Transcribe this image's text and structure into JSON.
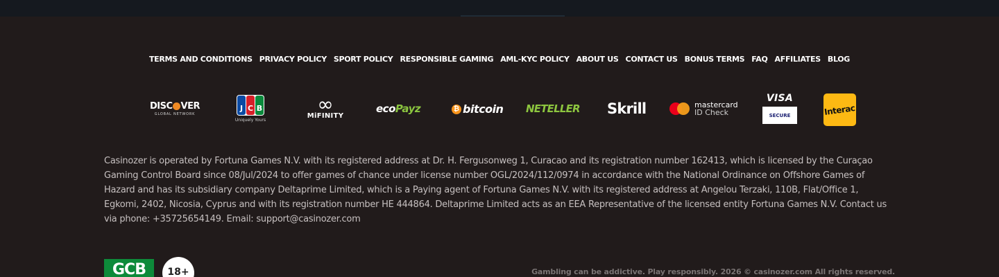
{
  "footer_links": [
    "TERMS AND CONDITIONS",
    "PRIVACY POLICY",
    "SPORT POLICY",
    "RESPONSIBLE GAMING",
    "AML-KYC POLICY",
    "ABOUT US",
    "CONTACT US",
    "BONUS TERMS",
    "FAQ",
    "AFFILIATES",
    "BLOG"
  ],
  "payments": {
    "discover": {
      "name_a": "DISC",
      "name_b": "VER",
      "sub": "GLOBAL NETWORK"
    },
    "jcb": {
      "j": "J",
      "c": "C",
      "b": "B",
      "sub": "Uniquely Yours"
    },
    "mifinity": {
      "name": "MiFINITY"
    },
    "ecopayz": {
      "eco": "eco",
      "payz": "Payz"
    },
    "bitcoin": {
      "symbol": "₿",
      "name": "bitcoin"
    },
    "neteller": {
      "name": "NETELLER"
    },
    "skrill": {
      "name": "Skrill"
    },
    "mastercard": {
      "line1": "mastercard",
      "line2": "ID Check"
    },
    "visa": {
      "name": "VISA",
      "box": "SECURE"
    },
    "interac": {
      "name": "Interac"
    }
  },
  "legal_text": "Casinozer is operated by Fortuna Games N.V. with its registered address at Dr. H. Fergusonweg 1, Curacao and its registration number 162413, which is licensed by the Curaçao Gaming Control Board since 08/Jul/2024 to offer games of chance under license number OGL/2024/112/0974 in accordance with the National Ordinance on Offshore Games of Hazard and has its subsidiary company Deltaprime Limited, which is a Paying agent of Fortuna Games N.V. with its registered address at Angelou Terzaki, 110B, Flat/Office 1, Egkomi, 2402, Nicosia, Cyprus and with its registration number HE 444864. Deltaprime Limited acts as an EEA Representative of the licensed entity Fortuna Games N.V. Contact us via phone: +35725654149. Email: support@casinozer.com",
  "badges": {
    "gcb": "GCB",
    "age": "18+"
  },
  "copyright": "Gambling can be addictive. Play responsibly. 2026 © casinozer.com All rights reserved.",
  "colors": {
    "background": "#211b1b",
    "link": "#ffffff",
    "legal_text": "#c6c0c0",
    "gcb_green": "#0d8a3a",
    "interac_yellow": "#fdb913"
  }
}
